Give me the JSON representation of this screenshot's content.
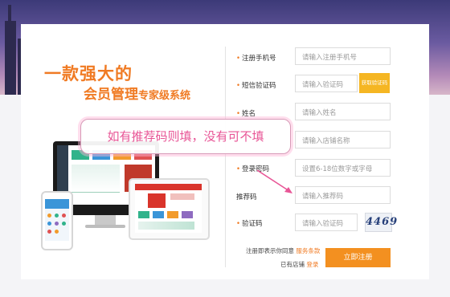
{
  "promo": {
    "line1": "一款强大的",
    "line2_main": "会员管理",
    "line2_sub": "专家级系统"
  },
  "form": {
    "phone": {
      "label": "注册手机号",
      "placeholder": "请输入注册手机号"
    },
    "sms": {
      "label": "短信验证码",
      "placeholder": "请输入验证码",
      "button": "获取验证码"
    },
    "name": {
      "label": "姓名",
      "placeholder": "请输入姓名"
    },
    "store": {
      "placeholder": "请输入店铺名称"
    },
    "password": {
      "label": "登录密码",
      "placeholder": "设置6-18位数字或字母"
    },
    "referral": {
      "label": "推荐码",
      "placeholder": "请输入推荐码"
    },
    "captcha": {
      "label": "验证码",
      "placeholder": "请输入验证码",
      "image_text": "4469"
    },
    "agree_prefix": "注册即表示你同意",
    "agree_link": "服务条款",
    "has_store": "已有店铺",
    "login_link": "登录",
    "register_button": "立即注册"
  },
  "tooltip": "如有推荐码则填，没有可不填",
  "colors": {
    "accent": "#f07b24",
    "button": "#f39020",
    "sms_button": "#f5b623",
    "tooltip_text": "#e85596"
  }
}
